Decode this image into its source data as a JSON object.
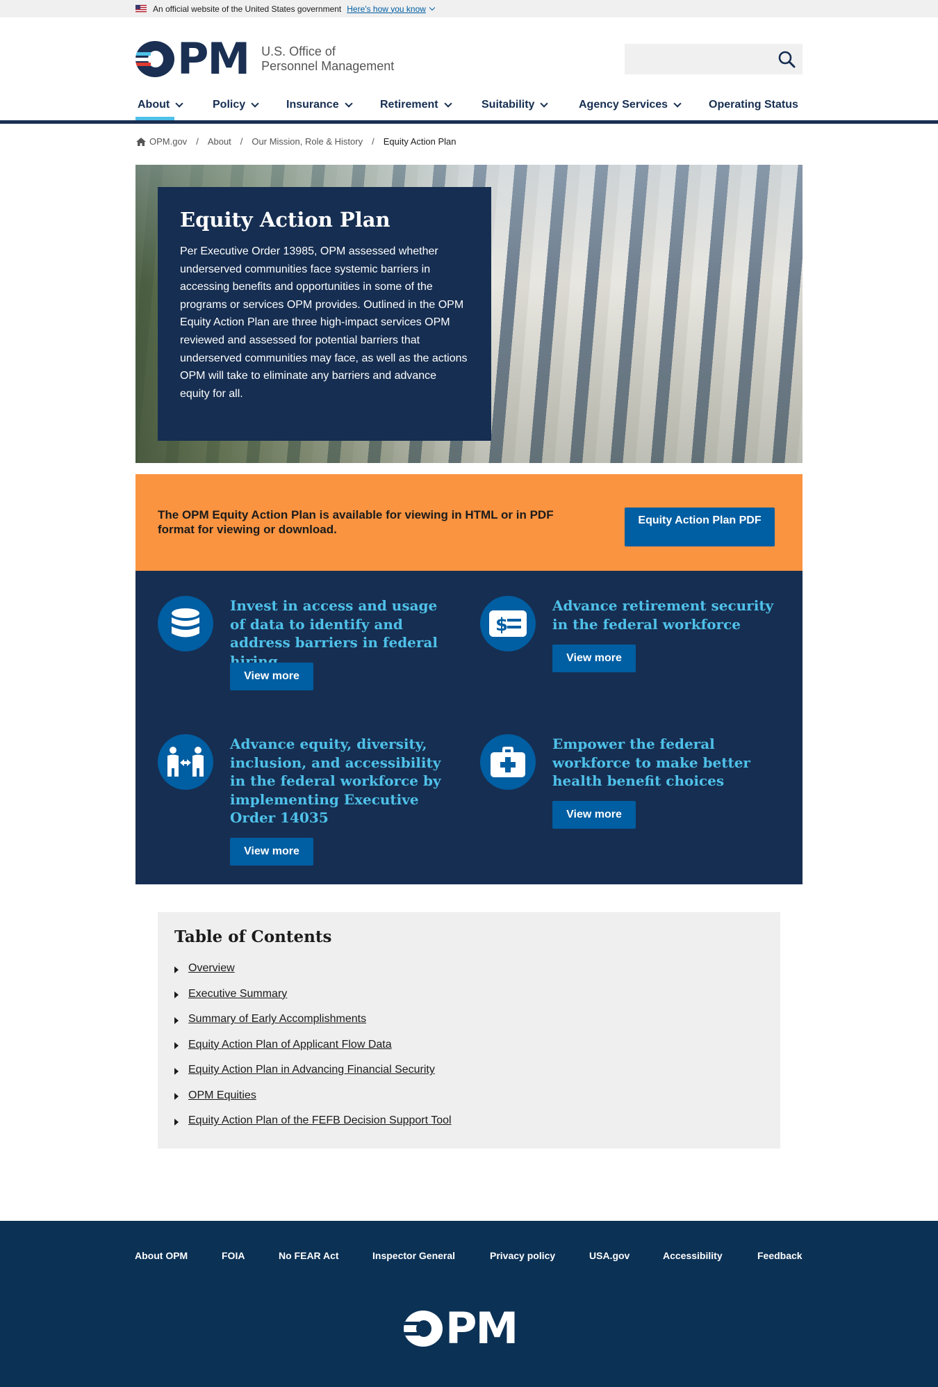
{
  "gov_banner": {
    "text": "An official website of the United States government",
    "link": "Here's how you know"
  },
  "header": {
    "logo_mark": "PM",
    "logo_line1": "U.S. Office of",
    "logo_line2": "Personnel Management",
    "search_placeholder": ""
  },
  "nav": {
    "items": [
      {
        "label": "About",
        "dropdown": true,
        "active": true
      },
      {
        "label": "Policy",
        "dropdown": true
      },
      {
        "label": "Insurance",
        "dropdown": true
      },
      {
        "label": "Retirement",
        "dropdown": true
      },
      {
        "label": "Suitability",
        "dropdown": true
      },
      {
        "label": "Agency Services",
        "dropdown": true
      },
      {
        "label": "Operating Status",
        "dropdown": false
      }
    ]
  },
  "breadcrumb": {
    "items": [
      "OPM.gov",
      "About",
      "Our Mission, Role & History",
      "Equity Action Plan"
    ]
  },
  "hero": {
    "title": "Equity Action Plan",
    "body": "Per Executive Order 13985, OPM assessed whether underserved communities face systemic barriers in accessing benefits and opportunities in some of the programs or services OPM provides. Outlined in the OPM Equity Action Plan are three high-impact services OPM reviewed and assessed for potential barriers that underserved communities may face, as well as the actions OPM will take to eliminate any barriers and advance equity for all."
  },
  "callout": {
    "text": "The OPM Equity Action Plan is available for viewing in HTML or in PDF format for viewing or download.",
    "button": "Equity Action Plan PDF"
  },
  "cards": [
    {
      "title": "Invest in access and usage of data to identify and address barriers in federal hiring",
      "button": "View more",
      "icon": "database-icon"
    },
    {
      "title": "Advance retirement security in the federal workforce",
      "button": "View more",
      "icon": "money-card-icon"
    },
    {
      "title": "Advance equity, diversity, inclusion, and accessibility in the federal workforce by implementing Executive Order 14035",
      "button": "View more",
      "icon": "people-arrows-icon"
    },
    {
      "title": "Empower the federal workforce to make better health benefit choices",
      "button": "View more",
      "icon": "medical-kit-icon"
    }
  ],
  "toc": {
    "title": "Table of Contents",
    "items": [
      "Overview",
      "Executive Summary",
      "Summary of Early Accomplishments",
      "Equity Action Plan of Applicant Flow Data",
      "Equity Action Plan in Advancing Financial Security",
      "OPM Equities",
      "Equity Action Plan of the FEFB Decision Support Tool"
    ]
  },
  "footer": {
    "links": [
      "About OPM",
      "FOIA",
      "No FEAR Act",
      "Inspector General",
      "Privacy policy",
      "USA.gov",
      "Accessibility",
      "Feedback"
    ],
    "logo_mark": "PM"
  },
  "colors": {
    "navy": "#162e51",
    "primary_blue": "#005ea2",
    "accent_cyan": "#4fc1e9",
    "orange": "#fa9441",
    "footer_bg": "#0b3155"
  }
}
